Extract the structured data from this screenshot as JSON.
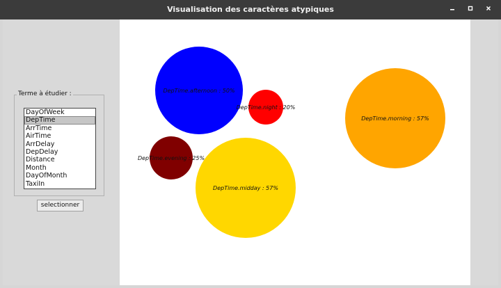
{
  "window": {
    "title": "Visualisation des caractères atypiques",
    "minimize_icon": "minimize-icon",
    "maximize_icon": "maximize-icon",
    "close_icon": "close-icon"
  },
  "sidebar": {
    "group_label": "Terme à étudier :",
    "list_items": [
      "DayOfWeek",
      "DepTime",
      "ArrTime",
      "AirTime",
      "ArrDelay",
      "DepDelay",
      "Distance",
      "Month",
      "DayOfMonth",
      "TaxiIn"
    ],
    "selected_item": "DepTime",
    "button_label": "selectionner"
  },
  "chart_data": {
    "type": "bubble",
    "title": "",
    "bubbles": [
      {
        "label": "DepTime.afternoon : 50%",
        "value": 50,
        "color": "#0000ff"
      },
      {
        "label": "DepTime.night : 20%",
        "value": 20,
        "color": "#ff0000"
      },
      {
        "label": "DepTime.morning : 57%",
        "value": 57,
        "color": "#ffa500"
      },
      {
        "label": "DepTime.evening : 25%",
        "value": 25,
        "color": "#800000"
      },
      {
        "label": "DepTime.midday : 57%",
        "value": 57,
        "color": "#ffd700"
      }
    ]
  }
}
